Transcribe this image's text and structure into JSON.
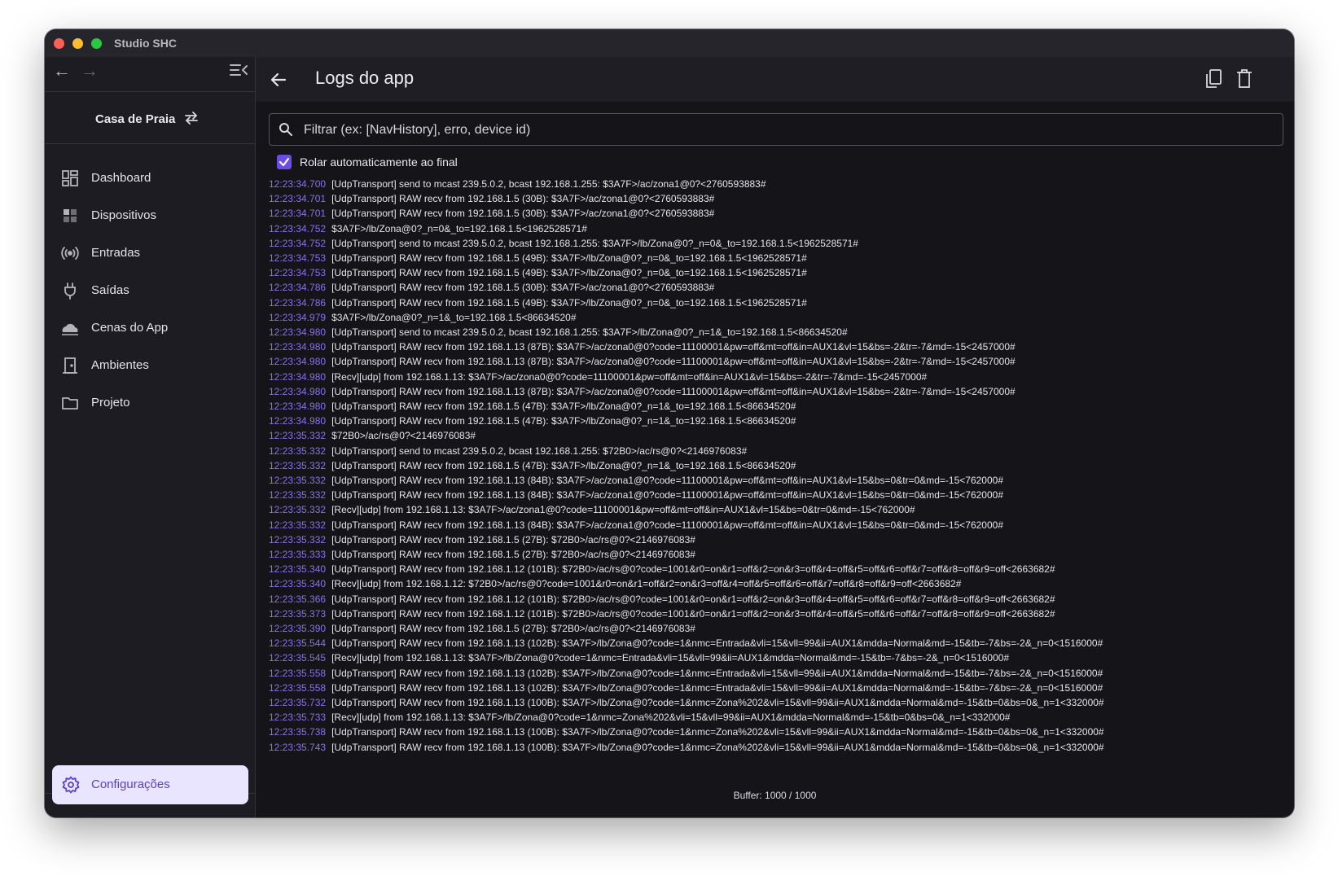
{
  "window": {
    "title": "Studio SHC"
  },
  "sidebar": {
    "home": {
      "label": "Casa de Praia"
    },
    "items": [
      {
        "label": "Dashboard",
        "icon": "dashboard-icon"
      },
      {
        "label": "Dispositivos",
        "icon": "devices-icon"
      },
      {
        "label": "Entradas",
        "icon": "inputs-icon"
      },
      {
        "label": "Saídas",
        "icon": "plug-icon"
      },
      {
        "label": "Cenas do App",
        "icon": "cloud-icon"
      },
      {
        "label": "Ambientes",
        "icon": "door-icon"
      },
      {
        "label": "Projeto",
        "icon": "folder-icon"
      }
    ],
    "settings": {
      "label": "Configurações",
      "icon": "gear-icon"
    }
  },
  "header": {
    "title": "Logs do app"
  },
  "filter": {
    "placeholder": "Filtrar (ex: [NavHistory], erro, device id)",
    "value": ""
  },
  "autoscroll": {
    "label": "Rolar automaticamente ao final",
    "checked": true
  },
  "logs": [
    {
      "ts": "12:23:34.700",
      "msg": "[UdpTransport] send to mcast 239.5.0.2, bcast 192.168.1.255: $3A7F>/ac/zona1@0?<2760593883#"
    },
    {
      "ts": "12:23:34.701",
      "msg": "[UdpTransport] RAW recv from 192.168.1.5 (30B): $3A7F>/ac/zona1@0?<2760593883#"
    },
    {
      "ts": "12:23:34.701",
      "msg": "[UdpTransport] RAW recv from 192.168.1.5 (30B): $3A7F>/ac/zona1@0?<2760593883#"
    },
    {
      "ts": "12:23:34.752",
      "msg": "$3A7F>/lb/Zona@0?_n=0&_to=192.168.1.5<1962528571#"
    },
    {
      "ts": "12:23:34.752",
      "msg": "[UdpTransport] send to mcast 239.5.0.2, bcast 192.168.1.255: $3A7F>/lb/Zona@0?_n=0&_to=192.168.1.5<1962528571#"
    },
    {
      "ts": "12:23:34.753",
      "msg": "[UdpTransport] RAW recv from 192.168.1.5 (49B): $3A7F>/lb/Zona@0?_n=0&_to=192.168.1.5<1962528571#"
    },
    {
      "ts": "12:23:34.753",
      "msg": "[UdpTransport] RAW recv from 192.168.1.5 (49B): $3A7F>/lb/Zona@0?_n=0&_to=192.168.1.5<1962528571#"
    },
    {
      "ts": "12:23:34.786",
      "msg": "[UdpTransport] RAW recv from 192.168.1.5 (30B): $3A7F>/ac/zona1@0?<2760593883#"
    },
    {
      "ts": "12:23:34.786",
      "msg": "[UdpTransport] RAW recv from 192.168.1.5 (49B): $3A7F>/lb/Zona@0?_n=0&_to=192.168.1.5<1962528571#"
    },
    {
      "ts": "12:23:34.979",
      "msg": "$3A7F>/lb/Zona@0?_n=1&_to=192.168.1.5<86634520#"
    },
    {
      "ts": "12:23:34.980",
      "msg": "[UdpTransport] send to mcast 239.5.0.2, bcast 192.168.1.255: $3A7F>/lb/Zona@0?_n=1&_to=192.168.1.5<86634520#"
    },
    {
      "ts": "12:23:34.980",
      "msg": "[UdpTransport] RAW recv from 192.168.1.13 (87B): $3A7F>/ac/zona0@0?code=11100001&pw=off&mt=off&in=AUX1&vl=15&bs=-2&tr=-7&md=-15<2457000#"
    },
    {
      "ts": "12:23:34.980",
      "msg": "[UdpTransport] RAW recv from 192.168.1.13 (87B): $3A7F>/ac/zona0@0?code=11100001&pw=off&mt=off&in=AUX1&vl=15&bs=-2&tr=-7&md=-15<2457000#"
    },
    {
      "ts": "12:23:34.980",
      "msg": "[Recv][udp] from 192.168.1.13: $3A7F>/ac/zona0@0?code=11100001&pw=off&mt=off&in=AUX1&vl=15&bs=-2&tr=-7&md=-15<2457000#"
    },
    {
      "ts": "12:23:34.980",
      "msg": "[UdpTransport] RAW recv from 192.168.1.13 (87B): $3A7F>/ac/zona0@0?code=11100001&pw=off&mt=off&in=AUX1&vl=15&bs=-2&tr=-7&md=-15<2457000#"
    },
    {
      "ts": "12:23:34.980",
      "msg": "[UdpTransport] RAW recv from 192.168.1.5 (47B): $3A7F>/lb/Zona@0?_n=1&_to=192.168.1.5<86634520#"
    },
    {
      "ts": "12:23:34.980",
      "msg": "[UdpTransport] RAW recv from 192.168.1.5 (47B): $3A7F>/lb/Zona@0?_n=1&_to=192.168.1.5<86634520#"
    },
    {
      "ts": "12:23:35.332",
      "msg": "$72B0>/ac/rs@0?<2146976083#"
    },
    {
      "ts": "12:23:35.332",
      "msg": "[UdpTransport] send to mcast 239.5.0.2, bcast 192.168.1.255: $72B0>/ac/rs@0?<2146976083#"
    },
    {
      "ts": "12:23:35.332",
      "msg": "[UdpTransport] RAW recv from 192.168.1.5 (47B): $3A7F>/lb/Zona@0?_n=1&_to=192.168.1.5<86634520#"
    },
    {
      "ts": "12:23:35.332",
      "msg": "[UdpTransport] RAW recv from 192.168.1.13 (84B): $3A7F>/ac/zona1@0?code=11100001&pw=off&mt=off&in=AUX1&vl=15&bs=0&tr=0&md=-15<762000#"
    },
    {
      "ts": "12:23:35.332",
      "msg": "[UdpTransport] RAW recv from 192.168.1.13 (84B): $3A7F>/ac/zona1@0?code=11100001&pw=off&mt=off&in=AUX1&vl=15&bs=0&tr=0&md=-15<762000#"
    },
    {
      "ts": "12:23:35.332",
      "msg": "[Recv][udp] from 192.168.1.13: $3A7F>/ac/zona1@0?code=11100001&pw=off&mt=off&in=AUX1&vl=15&bs=0&tr=0&md=-15<762000#"
    },
    {
      "ts": "12:23:35.332",
      "msg": "[UdpTransport] RAW recv from 192.168.1.13 (84B): $3A7F>/ac/zona1@0?code=11100001&pw=off&mt=off&in=AUX1&vl=15&bs=0&tr=0&md=-15<762000#"
    },
    {
      "ts": "12:23:35.332",
      "msg": "[UdpTransport] RAW recv from 192.168.1.5 (27B): $72B0>/ac/rs@0?<2146976083#"
    },
    {
      "ts": "12:23:35.333",
      "msg": "[UdpTransport] RAW recv from 192.168.1.5 (27B): $72B0>/ac/rs@0?<2146976083#"
    },
    {
      "ts": "12:23:35.340",
      "msg": "[UdpTransport] RAW recv from 192.168.1.12 (101B): $72B0>/ac/rs@0?code=1001&r0=on&r1=off&r2=on&r3=off&r4=off&r5=off&r6=off&r7=off&r8=off&r9=off<2663682#"
    },
    {
      "ts": "12:23:35.340",
      "msg": "[Recv][udp] from 192.168.1.12: $72B0>/ac/rs@0?code=1001&r0=on&r1=off&r2=on&r3=off&r4=off&r5=off&r6=off&r7=off&r8=off&r9=off<2663682#"
    },
    {
      "ts": "12:23:35.366",
      "msg": "[UdpTransport] RAW recv from 192.168.1.12 (101B): $72B0>/ac/rs@0?code=1001&r0=on&r1=off&r2=on&r3=off&r4=off&r5=off&r6=off&r7=off&r8=off&r9=off<2663682#"
    },
    {
      "ts": "12:23:35.373",
      "msg": "[UdpTransport] RAW recv from 192.168.1.12 (101B): $72B0>/ac/rs@0?code=1001&r0=on&r1=off&r2=on&r3=off&r4=off&r5=off&r6=off&r7=off&r8=off&r9=off<2663682#"
    },
    {
      "ts": "12:23:35.390",
      "msg": "[UdpTransport] RAW recv from 192.168.1.5 (27B): $72B0>/ac/rs@0?<2146976083#"
    },
    {
      "ts": "12:23:35.544",
      "msg": "[UdpTransport] RAW recv from 192.168.1.13 (102B): $3A7F>/lb/Zona@0?code=1&nmc=Entrada&vli=15&vll=99&ii=AUX1&mdda=Normal&md=-15&tb=-7&bs=-2&_n=0<1516000#"
    },
    {
      "ts": "12:23:35.545",
      "msg": "[Recv][udp] from 192.168.1.13: $3A7F>/lb/Zona@0?code=1&nmc=Entrada&vli=15&vll=99&ii=AUX1&mdda=Normal&md=-15&tb=-7&bs=-2&_n=0<1516000#"
    },
    {
      "ts": "12:23:35.558",
      "msg": "[UdpTransport] RAW recv from 192.168.1.13 (102B): $3A7F>/lb/Zona@0?code=1&nmc=Entrada&vli=15&vll=99&ii=AUX1&mdda=Normal&md=-15&tb=-7&bs=-2&_n=0<1516000#"
    },
    {
      "ts": "12:23:35.558",
      "msg": "[UdpTransport] RAW recv from 192.168.1.13 (102B): $3A7F>/lb/Zona@0?code=1&nmc=Entrada&vli=15&vll=99&ii=AUX1&mdda=Normal&md=-15&tb=-7&bs=-2&_n=0<1516000#"
    },
    {
      "ts": "12:23:35.732",
      "msg": "[UdpTransport] RAW recv from 192.168.1.13 (100B): $3A7F>/lb/Zona@0?code=1&nmc=Zona%202&vli=15&vll=99&ii=AUX1&mdda=Normal&md=-15&tb=0&bs=0&_n=1<332000#"
    },
    {
      "ts": "12:23:35.733",
      "msg": "[Recv][udp] from 192.168.1.13: $3A7F>/lb/Zona@0?code=1&nmc=Zona%202&vli=15&vll=99&ii=AUX1&mdda=Normal&md=-15&tb=0&bs=0&_n=1<332000#"
    },
    {
      "ts": "12:23:35.738",
      "msg": "[UdpTransport] RAW recv from 192.168.1.13 (100B): $3A7F>/lb/Zona@0?code=1&nmc=Zona%202&vli=15&vll=99&ii=AUX1&mdda=Normal&md=-15&tb=0&bs=0&_n=1<332000#"
    },
    {
      "ts": "12:23:35.743",
      "msg": "[UdpTransport] RAW recv from 192.168.1.13 (100B): $3A7F>/lb/Zona@0?code=1&nmc=Zona%202&vli=15&vll=99&ii=AUX1&mdda=Normal&md=-15&tb=0&bs=0&_n=1<332000#"
    }
  ],
  "footer": {
    "buffer": "Buffer: 1000 / 1000"
  },
  "colors": {
    "accent": "#6c4ce6",
    "timestamp": "#8b72ec",
    "settings_bg": "#e9e4ff"
  }
}
